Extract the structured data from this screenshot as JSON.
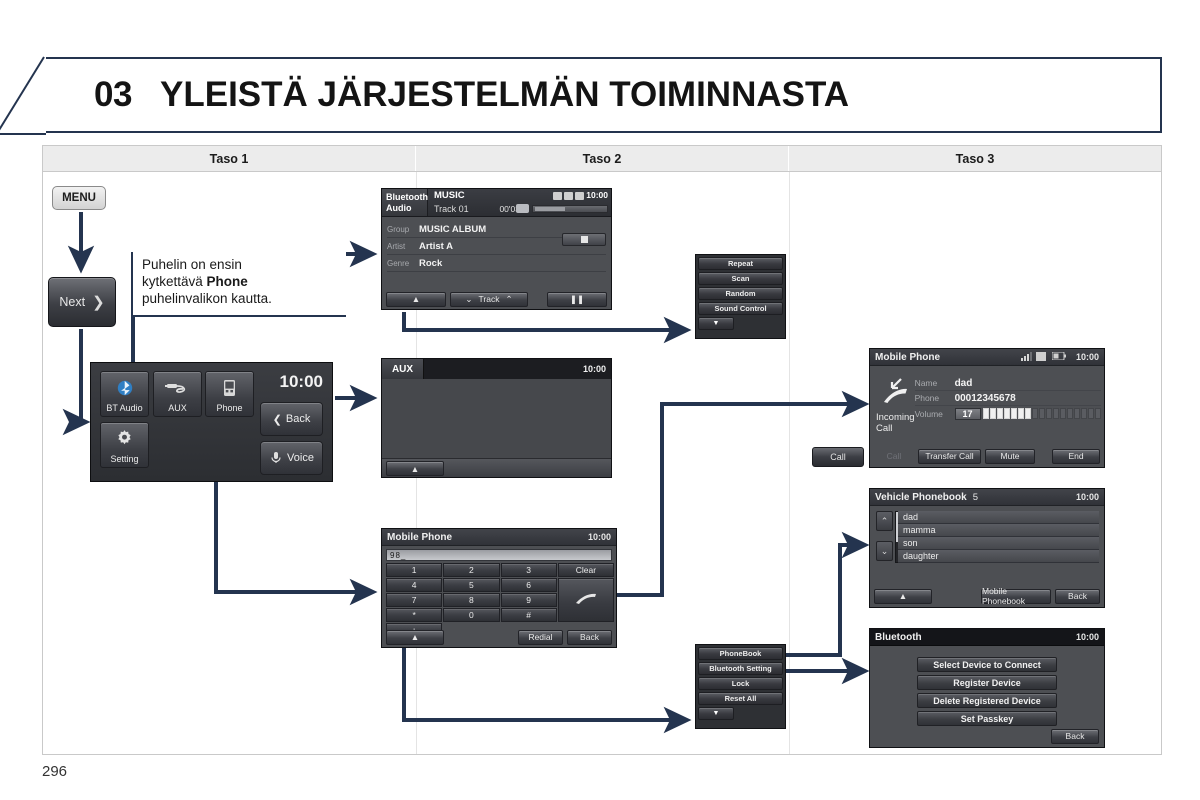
{
  "page": {
    "chapter_number": "03",
    "chapter_title": "YLEISTÄ JÄRJESTELMÄN TOIMINNASTA",
    "page_number": "296"
  },
  "columns": [
    {
      "label": "Taso 1"
    },
    {
      "label": "Taso 2"
    },
    {
      "label": "Taso 3"
    }
  ],
  "buttons": {
    "menu": "MENU",
    "next": "Next",
    "next_chevron": "chevron-right-icon",
    "call": "Call"
  },
  "callout": {
    "line1": "Puhelin on ensin",
    "line2_pre": "kytkettävä ",
    "line2_bold": "Phone",
    "line3": "puhelinvalikon kautta."
  },
  "bt_audio_screen": {
    "badge_line1": "Bluetooth",
    "badge_line2": "Audio",
    "source": "MUSIC",
    "track": "Track 01",
    "elapsed": "00'03\"",
    "clock": "10:00",
    "rows": [
      {
        "key": "Group",
        "value": "MUSIC ALBUM"
      },
      {
        "key": "Artist",
        "value": "Artist A"
      },
      {
        "key": "Genre",
        "value": "Rock"
      }
    ],
    "stop_icon": "stop-icon",
    "up_icon": "triangle-up-icon",
    "track_prev_icon": "chevron-down-icon",
    "track_label": "Track",
    "track_next_icon": "chevron-up-icon",
    "pause_icon": "pause-icon"
  },
  "audio_menu": {
    "items": [
      "Repeat",
      "Scan",
      "Random",
      "Sound Control"
    ],
    "more_icon": "triangle-down-icon"
  },
  "aux_screen": {
    "title": "AUX",
    "clock": "10:00",
    "up_icon": "triangle-up-icon"
  },
  "home_screen": {
    "clock": "10:00",
    "tiles": [
      {
        "label": "BT Audio",
        "icon": "bluetooth-icon"
      },
      {
        "label": "AUX",
        "icon": "aux-plug-icon"
      },
      {
        "label": "Phone",
        "icon": "phone-handset-icon"
      },
      {
        "label": "Setting",
        "icon": "gear-icon"
      }
    ],
    "back_label": "Back",
    "back_icon": "chevron-left-icon",
    "voice_label": "Voice",
    "voice_icon": "voice-icon"
  },
  "keypad_screen": {
    "title": "Mobile Phone",
    "clock": "10:00",
    "input_value": "98_",
    "keys": [
      "1",
      "2",
      "3",
      "4",
      "5",
      "6",
      "7",
      "8",
      "9",
      "*",
      "0",
      "#"
    ],
    "clear_label": "Clear",
    "call_icon": "phone-handset-icon",
    "plus_label": "+",
    "redial_label": "Redial",
    "back_label": "Back",
    "up_icon": "triangle-up-icon"
  },
  "phone_menu": {
    "items": [
      "PhoneBook",
      "Bluetooth Setting",
      "Lock",
      "Reset All"
    ],
    "more_icon": "triangle-down-icon"
  },
  "incoming_call_screen": {
    "title": "Mobile Phone",
    "clock": "10:00",
    "signal_icon": "signal-bars-icon",
    "battery_icon": "battery-icon",
    "status_label": "Incoming Call",
    "call_icon": "incoming-call-icon",
    "rows": [
      {
        "key": "Name",
        "value": "dad"
      },
      {
        "key": "Phone",
        "value": "00012345678"
      }
    ],
    "volume_key": "Volume",
    "volume_value": "17",
    "volume_segments_total": 18,
    "volume_segments_on": 7,
    "footer": {
      "call": "Call",
      "transfer": "Transfer Call",
      "mute": "Mute",
      "end": "End"
    }
  },
  "phonebook_screen": {
    "title": "Vehicle Phonebook",
    "count": "5",
    "clock": "10:00",
    "entries": [
      "dad",
      "mamma",
      "son",
      "daughter"
    ],
    "scroll_up_icon": "chevron-up-icon",
    "scroll_down_icon": "chevron-down-icon",
    "up_icon": "triangle-up-icon",
    "mobile_phonebook_label": "Mobile Phonebook",
    "back_label": "Back"
  },
  "bluetooth_screen": {
    "title": "Bluetooth",
    "clock": "10:00",
    "options": [
      "Select Device to  Connect",
      "Register Device",
      "Delete Registered Device",
      "Set Passkey"
    ],
    "back_label": "Back"
  },
  "colors": {
    "connector": "#24344f",
    "header_border": "#24344f",
    "column_header_bg": "#ececec",
    "screen_bg": "#4d4f53"
  }
}
